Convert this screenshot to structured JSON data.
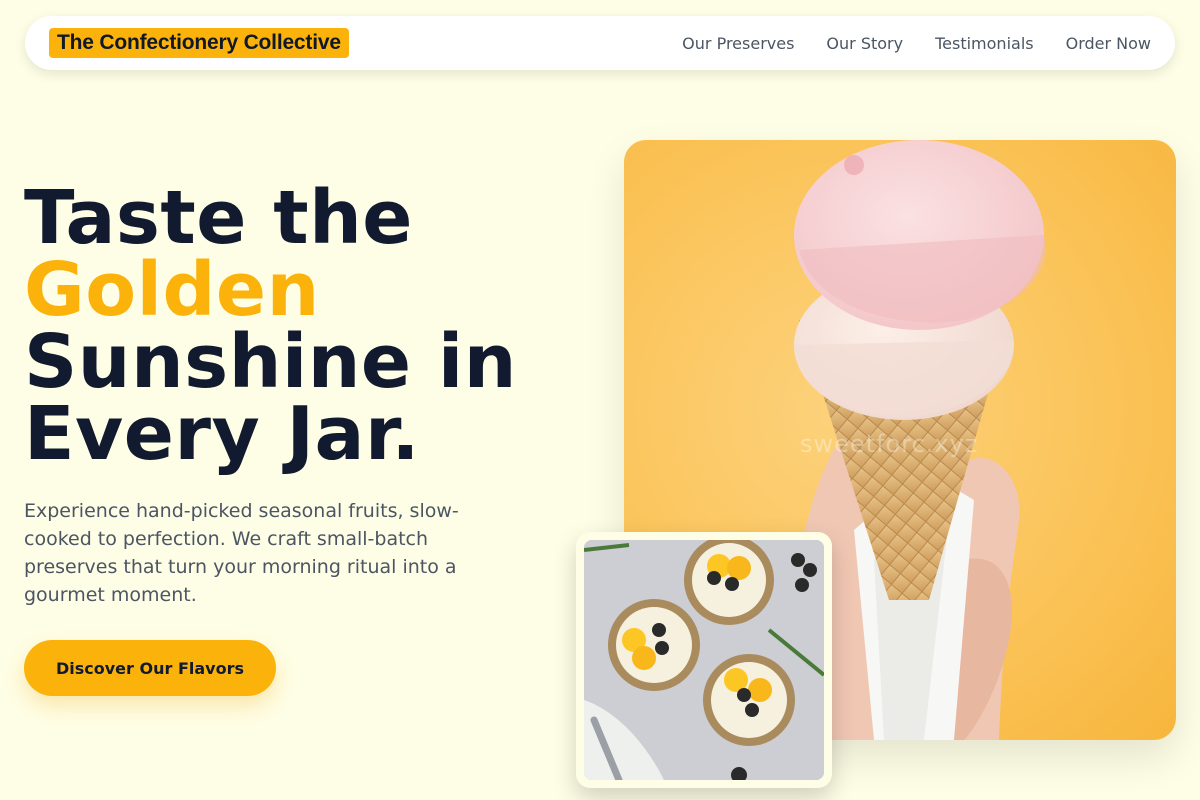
{
  "brand": {
    "name": "The Confectionery Collective"
  },
  "nav": {
    "links": [
      "Our Preserves",
      "Our Story",
      "Testimonials",
      "Order Now"
    ]
  },
  "hero": {
    "title_line1": "Taste the",
    "title_accent": "Golden",
    "title_line3": "Sunshine in",
    "title_line4": "Every Jar.",
    "description": "Experience hand-picked seasonal fruits, slow-cooked to perfection. We craft small-batch preserves that turn your morning ritual into a gourmet moment.",
    "cta_label": "Discover Our Flavors",
    "image_watermark": "sweetforc.xyz"
  },
  "colors": {
    "accent": "#fbb30c",
    "background": "#fefee6",
    "heading": "#111a2e",
    "body_text": "#4b5563"
  },
  "icons": {
    "hero_image": "ice-cream-cone-photo",
    "thumb_image": "fruit-tarts-photo"
  }
}
